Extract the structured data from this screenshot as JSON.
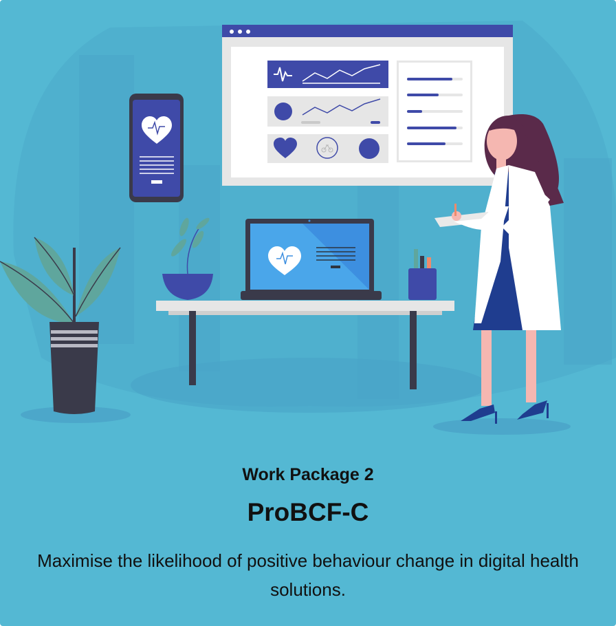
{
  "card": {
    "kicker": "Work Package 2",
    "title": "ProBCF-C",
    "description": "Maximise the likelihood of positive behaviour change in digital health solutions."
  },
  "illustration": {
    "subject": "doctor-with-clipboard-and-health-dashboard",
    "icons": [
      "heart-pulse-icon",
      "line-chart-icon",
      "bike-icon"
    ]
  },
  "colors": {
    "background": "#54b8d3",
    "navy": "#3f4aa8",
    "dark": "#3a3a4a",
    "coat": "#ffffff",
    "hair": "#5a2a4a",
    "skin": "#f5b7b1",
    "leaf": "#5fa69d"
  }
}
